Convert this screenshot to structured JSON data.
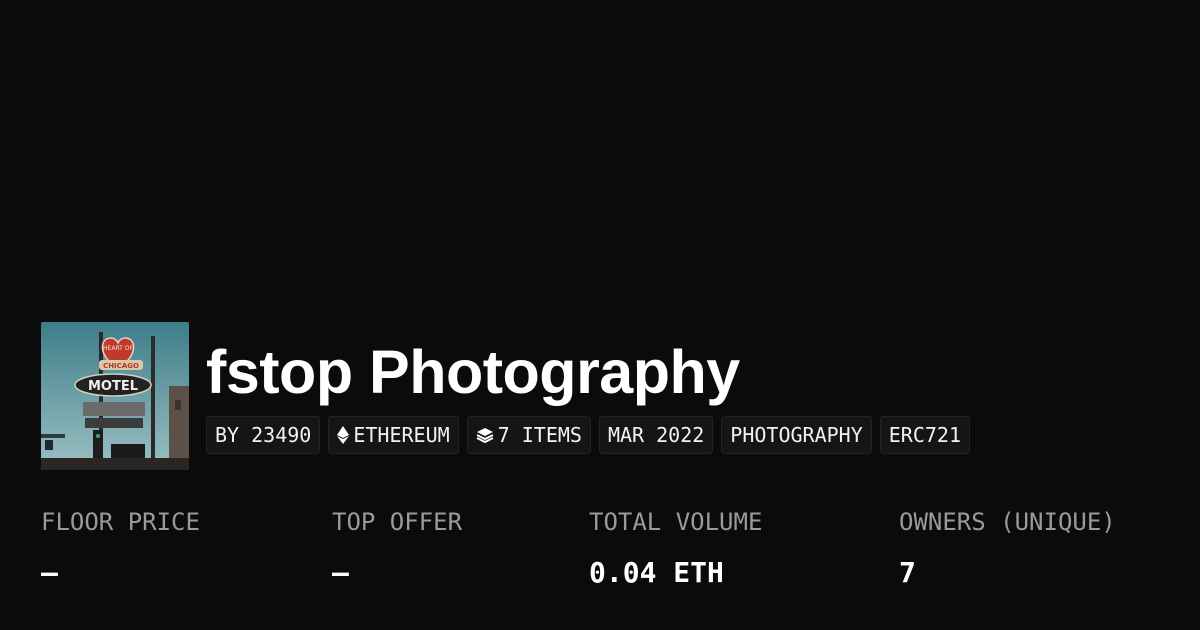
{
  "collection": {
    "title": "fstop Photography",
    "thumbnail": {
      "sign_top": "HEART OF",
      "sign_mid": "CHICAGO",
      "sign_main": "MOTEL"
    }
  },
  "tags": [
    {
      "label": "BY 23490",
      "icon": ""
    },
    {
      "label": "ETHEREUM",
      "icon": "ethereum-icon"
    },
    {
      "label": "7 ITEMS",
      "icon": "layers-icon"
    },
    {
      "label": "MAR 2022",
      "icon": ""
    },
    {
      "label": "PHOTOGRAPHY",
      "icon": ""
    },
    {
      "label": "ERC721",
      "icon": ""
    }
  ],
  "stats": [
    {
      "label": "FLOOR PRICE",
      "value": "–"
    },
    {
      "label": "TOP OFFER",
      "value": "–"
    },
    {
      "label": "TOTAL VOLUME",
      "value": "0.04 ETH"
    },
    {
      "label": "OWNERS (UNIQUE)",
      "value": "7"
    }
  ],
  "colors": {
    "background": "#0b0b0b",
    "text": "#ffffff",
    "muted": "#9a9a9a",
    "tag_bg": "#151515"
  }
}
